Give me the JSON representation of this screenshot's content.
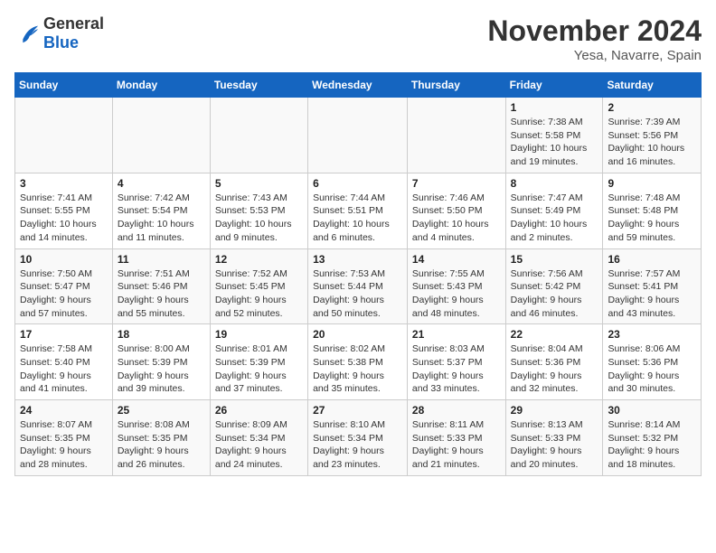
{
  "header": {
    "logo_general": "General",
    "logo_blue": "Blue",
    "title": "November 2024",
    "subtitle": "Yesa, Navarre, Spain"
  },
  "weekdays": [
    "Sunday",
    "Monday",
    "Tuesday",
    "Wednesday",
    "Thursday",
    "Friday",
    "Saturday"
  ],
  "weeks": [
    [
      {
        "day": "",
        "info": ""
      },
      {
        "day": "",
        "info": ""
      },
      {
        "day": "",
        "info": ""
      },
      {
        "day": "",
        "info": ""
      },
      {
        "day": "",
        "info": ""
      },
      {
        "day": "1",
        "info": "Sunrise: 7:38 AM\nSunset: 5:58 PM\nDaylight: 10 hours and 19 minutes."
      },
      {
        "day": "2",
        "info": "Sunrise: 7:39 AM\nSunset: 5:56 PM\nDaylight: 10 hours and 16 minutes."
      }
    ],
    [
      {
        "day": "3",
        "info": "Sunrise: 7:41 AM\nSunset: 5:55 PM\nDaylight: 10 hours and 14 minutes."
      },
      {
        "day": "4",
        "info": "Sunrise: 7:42 AM\nSunset: 5:54 PM\nDaylight: 10 hours and 11 minutes."
      },
      {
        "day": "5",
        "info": "Sunrise: 7:43 AM\nSunset: 5:53 PM\nDaylight: 10 hours and 9 minutes."
      },
      {
        "day": "6",
        "info": "Sunrise: 7:44 AM\nSunset: 5:51 PM\nDaylight: 10 hours and 6 minutes."
      },
      {
        "day": "7",
        "info": "Sunrise: 7:46 AM\nSunset: 5:50 PM\nDaylight: 10 hours and 4 minutes."
      },
      {
        "day": "8",
        "info": "Sunrise: 7:47 AM\nSunset: 5:49 PM\nDaylight: 10 hours and 2 minutes."
      },
      {
        "day": "9",
        "info": "Sunrise: 7:48 AM\nSunset: 5:48 PM\nDaylight: 9 hours and 59 minutes."
      }
    ],
    [
      {
        "day": "10",
        "info": "Sunrise: 7:50 AM\nSunset: 5:47 PM\nDaylight: 9 hours and 57 minutes."
      },
      {
        "day": "11",
        "info": "Sunrise: 7:51 AM\nSunset: 5:46 PM\nDaylight: 9 hours and 55 minutes."
      },
      {
        "day": "12",
        "info": "Sunrise: 7:52 AM\nSunset: 5:45 PM\nDaylight: 9 hours and 52 minutes."
      },
      {
        "day": "13",
        "info": "Sunrise: 7:53 AM\nSunset: 5:44 PM\nDaylight: 9 hours and 50 minutes."
      },
      {
        "day": "14",
        "info": "Sunrise: 7:55 AM\nSunset: 5:43 PM\nDaylight: 9 hours and 48 minutes."
      },
      {
        "day": "15",
        "info": "Sunrise: 7:56 AM\nSunset: 5:42 PM\nDaylight: 9 hours and 46 minutes."
      },
      {
        "day": "16",
        "info": "Sunrise: 7:57 AM\nSunset: 5:41 PM\nDaylight: 9 hours and 43 minutes."
      }
    ],
    [
      {
        "day": "17",
        "info": "Sunrise: 7:58 AM\nSunset: 5:40 PM\nDaylight: 9 hours and 41 minutes."
      },
      {
        "day": "18",
        "info": "Sunrise: 8:00 AM\nSunset: 5:39 PM\nDaylight: 9 hours and 39 minutes."
      },
      {
        "day": "19",
        "info": "Sunrise: 8:01 AM\nSunset: 5:39 PM\nDaylight: 9 hours and 37 minutes."
      },
      {
        "day": "20",
        "info": "Sunrise: 8:02 AM\nSunset: 5:38 PM\nDaylight: 9 hours and 35 minutes."
      },
      {
        "day": "21",
        "info": "Sunrise: 8:03 AM\nSunset: 5:37 PM\nDaylight: 9 hours and 33 minutes."
      },
      {
        "day": "22",
        "info": "Sunrise: 8:04 AM\nSunset: 5:36 PM\nDaylight: 9 hours and 32 minutes."
      },
      {
        "day": "23",
        "info": "Sunrise: 8:06 AM\nSunset: 5:36 PM\nDaylight: 9 hours and 30 minutes."
      }
    ],
    [
      {
        "day": "24",
        "info": "Sunrise: 8:07 AM\nSunset: 5:35 PM\nDaylight: 9 hours and 28 minutes."
      },
      {
        "day": "25",
        "info": "Sunrise: 8:08 AM\nSunset: 5:35 PM\nDaylight: 9 hours and 26 minutes."
      },
      {
        "day": "26",
        "info": "Sunrise: 8:09 AM\nSunset: 5:34 PM\nDaylight: 9 hours and 24 minutes."
      },
      {
        "day": "27",
        "info": "Sunrise: 8:10 AM\nSunset: 5:34 PM\nDaylight: 9 hours and 23 minutes."
      },
      {
        "day": "28",
        "info": "Sunrise: 8:11 AM\nSunset: 5:33 PM\nDaylight: 9 hours and 21 minutes."
      },
      {
        "day": "29",
        "info": "Sunrise: 8:13 AM\nSunset: 5:33 PM\nDaylight: 9 hours and 20 minutes."
      },
      {
        "day": "30",
        "info": "Sunrise: 8:14 AM\nSunset: 5:32 PM\nDaylight: 9 hours and 18 minutes."
      }
    ]
  ]
}
